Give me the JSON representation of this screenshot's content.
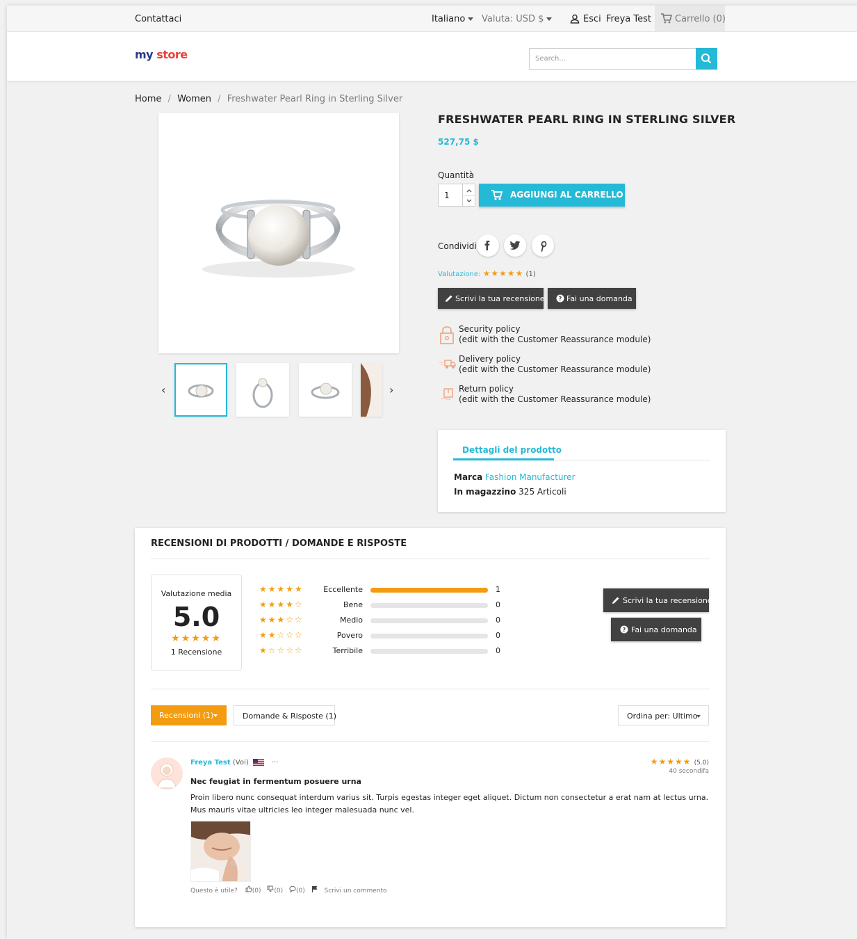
{
  "topnav": {
    "contact": "Contattaci",
    "language": "Italiano",
    "currency": "Valuta: USD $",
    "logout": "Esci",
    "user": "Freya Test",
    "cart": "Carrello (0)"
  },
  "header": {
    "logo_my": "my",
    "logo_store": "store",
    "search_placeholder": "Search..."
  },
  "breadcrumb": {
    "home": "Home",
    "sep": "/",
    "category": "Women",
    "current": "Freshwater Pearl Ring in Sterling Silver"
  },
  "product": {
    "title": "FRESHWATER PEARL RING IN STERLING SILVER",
    "price": "527,75 $",
    "qty_label": "Quantità",
    "qty_value": "1",
    "add_to_cart": "AGGIUNGI AL CARRELLO",
    "share_label": "Condividi",
    "rating_label": "Valutazione:",
    "rating_stars": "★★★★★",
    "rating_count": "(1)",
    "write_review": "Scrivi la tua recensione",
    "ask_question": "Fai una domanda"
  },
  "reassurance": [
    {
      "title": "Security policy",
      "desc": "(edit with the Customer Reassurance module)"
    },
    {
      "title": "Delivery policy",
      "desc": "(edit with the Customer Reassurance module)"
    },
    {
      "title": "Return policy",
      "desc": "(edit with the Customer Reassurance module)"
    }
  ],
  "details": {
    "tab": "Dettagli del prodotto",
    "brand_label": "Marca",
    "brand_value": "Fashion Manufacturer",
    "stock_label": "In magazzino",
    "stock_value": "325 Articoli"
  },
  "reviews": {
    "heading": "RECENSIONI DI PRODOTTI / DOMANDE E RISPOSTE",
    "avg_label": "Valutazione media",
    "avg_value": "5.0",
    "avg_stars": "★★★★★",
    "review_count": "1 Recensione",
    "rows": [
      {
        "stars": "★★★★★",
        "label": "Eccellente",
        "count": "1",
        "fraction": 1
      },
      {
        "stars": "★★★★☆",
        "label": "Bene",
        "count": "0",
        "fraction": 0
      },
      {
        "stars": "★★★☆☆",
        "label": "Medio",
        "count": "0",
        "fraction": 0
      },
      {
        "stars": "★★☆☆☆",
        "label": "Povero",
        "count": "0",
        "fraction": 0
      },
      {
        "stars": "★☆☆☆☆",
        "label": "Terribile",
        "count": "0",
        "fraction": 0
      }
    ],
    "write_review": "Scrivi la tua recensione",
    "ask_question": "Fai una domanda",
    "tab_reviews": "Recensioni (1)",
    "tab_qa": "Domande & Risposte (1)",
    "sort": "Ordina per: Ultimo",
    "item": {
      "author": "Freya Test",
      "you": "(Voi)",
      "more": "···",
      "stars": "★★★★★",
      "score": "(5.0)",
      "time": "40 secondifa",
      "title": "Nec feugiat in fermentum posuere urna",
      "body_line1": "Proin libero nunc consequat interdum varius sit. Turpis egestas integer eget aliquet. Dictum non consectetur a erat nam at lectus urna.",
      "body_line2": "Mus mauris vitae ultricies leo integer malesuada nunc vel.",
      "useful": "Questo è utile?",
      "likes": "(0)",
      "dislikes": "(0)",
      "comments": "(0)",
      "write_comment": "Scrivi un commento"
    }
  },
  "colors": {
    "accent": "#24b9d7",
    "star": "#f39c12",
    "dark_button": "#414141"
  }
}
